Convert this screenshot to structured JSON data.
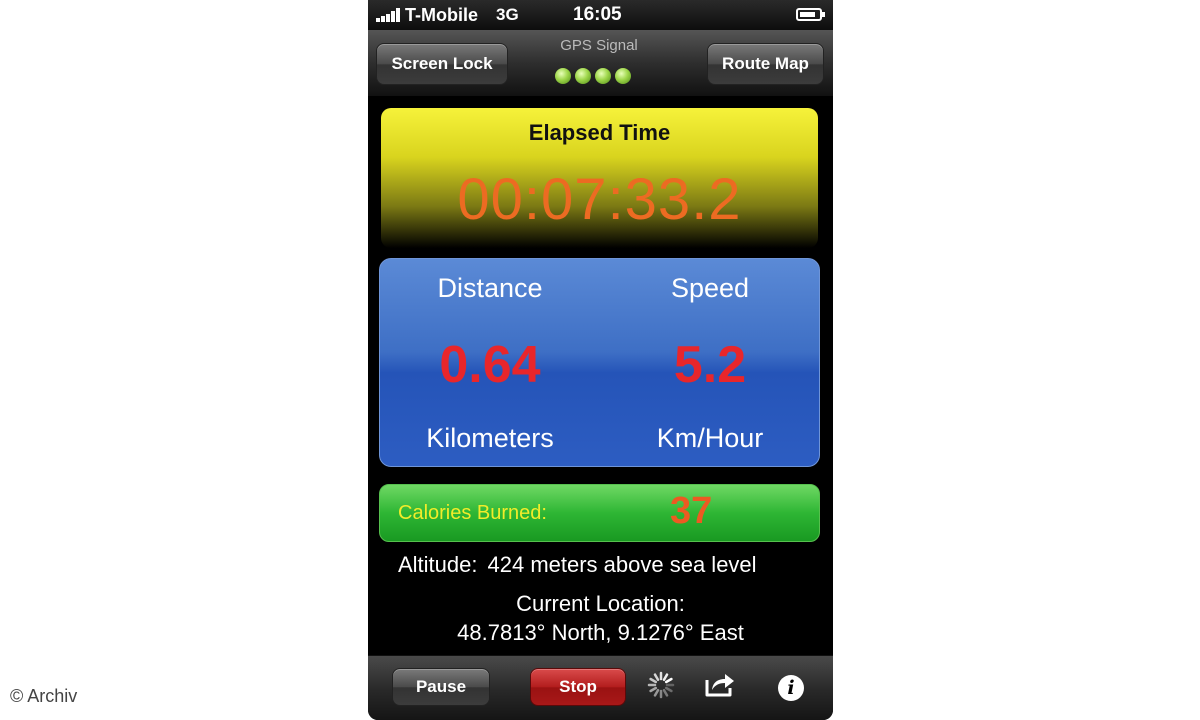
{
  "watermark": "© Archiv",
  "status_bar": {
    "carrier": "T-Mobile",
    "network": "3G",
    "time": "16:05",
    "battery_level": 0.85,
    "signal_bars": 5
  },
  "top_bar": {
    "screen_lock_label": "Screen Lock",
    "gps_label": "GPS Signal",
    "gps_strength_dots": 4,
    "route_map_label": "Route Map"
  },
  "elapsed": {
    "label": "Elapsed Time",
    "value": "00:07:33.2"
  },
  "metrics": {
    "distance": {
      "title": "Distance",
      "value": "0.64",
      "unit": "Kilometers"
    },
    "speed": {
      "title": "Speed",
      "value": "5.2",
      "unit": "Km/Hour"
    }
  },
  "calories": {
    "label": "Calories Burned:",
    "value": "37"
  },
  "altitude": {
    "label": "Altitude:",
    "value": "424 meters above sea level"
  },
  "location": {
    "title": "Current Location:",
    "value": "48.7813° North, 9.1276° East"
  },
  "bottom_bar": {
    "pause_label": "Pause",
    "stop_label": "Stop",
    "spinner_icon": "activity-spinner-icon",
    "share_icon": "share-arrow-icon",
    "info_glyph": "i"
  },
  "colors": {
    "elapsed_value": "#ec6b22",
    "metric_value": "#e8262b",
    "calories_label": "#f1ec2a",
    "calories_value": "#ec5a22",
    "gps_dot": "#9ed64a"
  }
}
